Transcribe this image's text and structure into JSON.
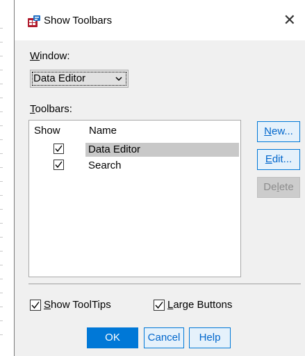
{
  "window": {
    "title": "Show Toolbars",
    "app_icon": "spss-app-icon",
    "close_icon": "close-icon"
  },
  "window_field": {
    "label": "Window:",
    "label_accel": "W",
    "label_rest": "indow:",
    "selected": "Data Editor"
  },
  "toolbars": {
    "label": "Toolbars:",
    "label_accel": "T",
    "label_rest": "oolbars:",
    "columns": {
      "show": "Show",
      "name": "Name"
    },
    "rows": [
      {
        "name": "Data Editor",
        "checked": true,
        "selected": true
      },
      {
        "name": "Search",
        "checked": true,
        "selected": false
      }
    ]
  },
  "side_buttons": {
    "new": {
      "label": "New...",
      "accel": "N",
      "rest": "ew..."
    },
    "edit": {
      "label": "Edit...",
      "accel": "E",
      "rest": "dit..."
    },
    "delete": {
      "label": "Delete",
      "pre": "De",
      "accel": "l",
      "rest": "ete",
      "disabled": true
    }
  },
  "options": {
    "show_tooltips": {
      "label": "Show ToolTips",
      "accel": "S",
      "rest": "how ToolTips",
      "checked": true
    },
    "large_buttons": {
      "label": "Large Buttons",
      "accel": "L",
      "rest": "arge Buttons",
      "checked": true
    }
  },
  "footer": {
    "ok": "OK",
    "cancel": "Cancel",
    "help": "Help"
  },
  "colors": {
    "accent": "#0078d7",
    "selection": "#c8c8c8",
    "dialog_bg": "#f0f0f0"
  }
}
